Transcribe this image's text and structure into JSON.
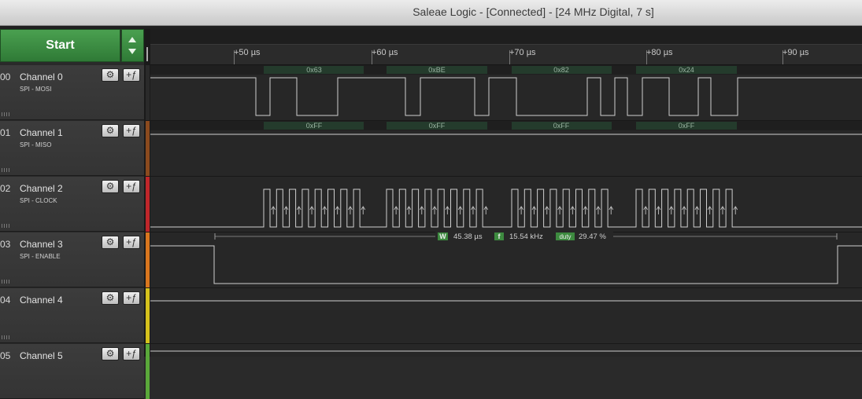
{
  "window": {
    "title": "Saleae Logic - [Connected] - [24 MHz Digital, 7 s]"
  },
  "toolbar": {
    "start_label": "Start"
  },
  "ruler": {
    "ticks": [
      "+50 µs",
      "+60 µs",
      "+70 µs",
      "+80 µs",
      "+90 µs"
    ]
  },
  "channels": [
    {
      "num": "00",
      "name": "Channel 0",
      "sub": "SPI - MOSI",
      "color": "#2a2a2a"
    },
    {
      "num": "01",
      "name": "Channel 1",
      "sub": "SPI - MISO",
      "color": "#8b4a1e"
    },
    {
      "num": "02",
      "name": "Channel 2",
      "sub": "SPI - CLOCK",
      "color": "#c0262a"
    },
    {
      "num": "03",
      "name": "Channel 3",
      "sub": "SPI - ENABLE",
      "color": "#d9761e"
    },
    {
      "num": "04",
      "name": "Channel 4",
      "sub": "",
      "color": "#d6c21c"
    },
    {
      "num": "05",
      "name": "Channel 5",
      "sub": "",
      "color": "#5aa83a"
    }
  ],
  "decode": {
    "mosi": [
      "0x63",
      "0xBE",
      "0x82",
      "0x24"
    ],
    "miso": [
      "0xFF",
      "0xFF",
      "0xFF",
      "0xFF"
    ]
  },
  "measure": {
    "width_tag": "W",
    "width_value": "45.38 µs",
    "freq_tag": "f",
    "freq_value": "15.54 kHz",
    "duty_tag": "duty",
    "duty_value": "29.47 %"
  },
  "icons": {
    "settings": "gear-icon",
    "trigger": "edge-trigger-icon"
  }
}
